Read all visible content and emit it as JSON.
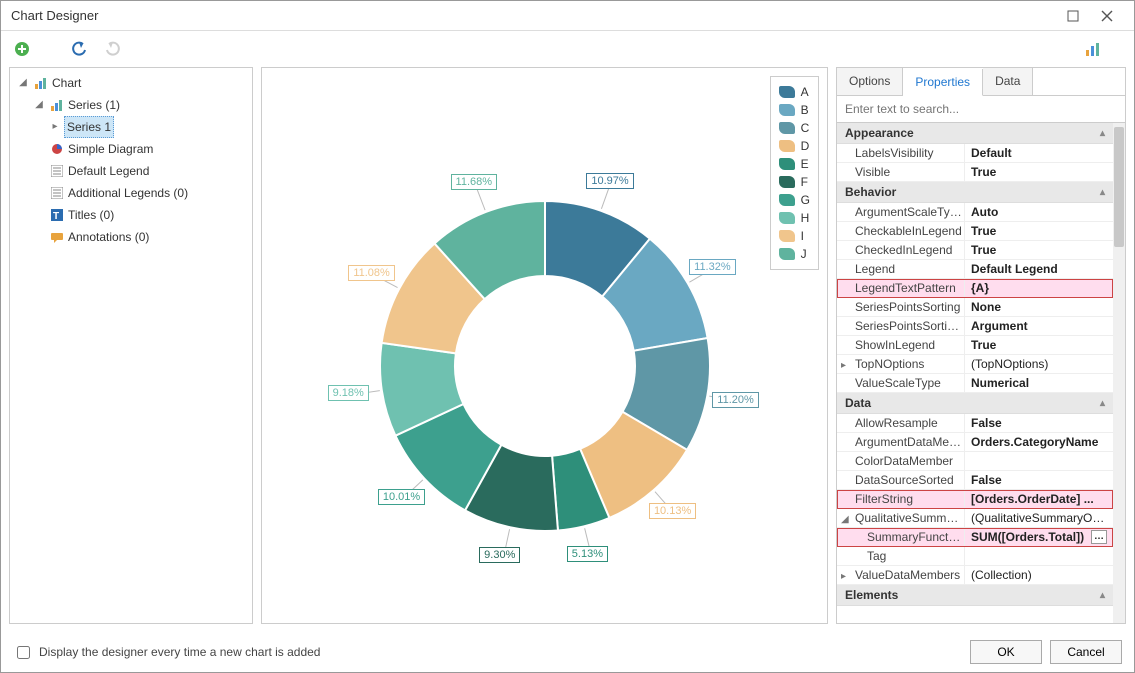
{
  "window": {
    "title": "Chart Designer"
  },
  "tree": {
    "root": "Chart",
    "series_group": "Series (1)",
    "series1": "Series 1",
    "simple_diagram": "Simple Diagram",
    "default_legend": "Default Legend",
    "additional_legends": "Additional Legends (0)",
    "titles": "Titles (0)",
    "annotations": "Annotations (0)"
  },
  "chart_data": {
    "type": "pie",
    "title": "",
    "categories": [
      "A",
      "B",
      "C",
      "D",
      "E",
      "F",
      "G",
      "H",
      "I",
      "J"
    ],
    "values": [
      10.97,
      11.32,
      11.2,
      10.13,
      5.13,
      9.3,
      10.01,
      9.18,
      11.08,
      11.68
    ],
    "labels": [
      "10.97%",
      "11.32%",
      "11.20%",
      "10.13%",
      "5.13%",
      "9.30%",
      "10.01%",
      "9.18%",
      "11.08%",
      "11.68%"
    ],
    "colors": [
      "#3c7a99",
      "#6aa8c2",
      "#5f97a6",
      "#eebf82",
      "#2e8f7a",
      "#2a6b5d",
      "#3da08e",
      "#6fc1b0",
      "#f0c58c",
      "#5fb39e"
    ]
  },
  "tabs": {
    "options": "Options",
    "properties": "Properties",
    "data": "Data"
  },
  "search": {
    "placeholder": "Enter text to search..."
  },
  "propgrid": {
    "cat_appearance": "Appearance",
    "labels_visibility": {
      "name": "LabelsVisibility",
      "value": "Default"
    },
    "visible": {
      "name": "Visible",
      "value": "True"
    },
    "cat_behavior": "Behavior",
    "argument_scale_type": {
      "name": "ArgumentScaleType",
      "value": "Auto"
    },
    "checkable_in_legend": {
      "name": "CheckableInLegend",
      "value": "True"
    },
    "checked_in_legend": {
      "name": "CheckedInLegend",
      "value": "True"
    },
    "legend": {
      "name": "Legend",
      "value": "Default Legend"
    },
    "legend_text_pattern": {
      "name": "LegendTextPattern",
      "value": "{A}"
    },
    "series_points_sorting": {
      "name": "SeriesPointsSorting",
      "value": "None"
    },
    "series_points_sorting_key": {
      "name": "SeriesPointsSorting...",
      "value": "Argument"
    },
    "show_in_legend": {
      "name": "ShowInLegend",
      "value": "True"
    },
    "topn_options": {
      "name": "TopNOptions",
      "value": "(TopNOptions)"
    },
    "value_scale_type": {
      "name": "ValueScaleType",
      "value": "Numerical"
    },
    "cat_data": "Data",
    "allow_resample": {
      "name": "AllowResample",
      "value": "False"
    },
    "argument_data_member": {
      "name": "ArgumentDataMem...",
      "value": "Orders.CategoryName"
    },
    "color_data_member": {
      "name": "ColorDataMember",
      "value": ""
    },
    "data_source_sorted": {
      "name": "DataSourceSorted",
      "value": "False"
    },
    "filter_string": {
      "name": "FilterString",
      "value": "[Orders.OrderDate] ..."
    },
    "qualitative_summary": {
      "name": "QualitativeSummary...",
      "value": "(QualitativeSummaryOpti..."
    },
    "summary_function": {
      "name": "SummaryFunction",
      "value": "SUM([Orders.Total])"
    },
    "tag": {
      "name": "Tag",
      "value": ""
    },
    "value_data_members": {
      "name": "ValueDataMembers",
      "value": "(Collection)"
    },
    "cat_elements": "Elements"
  },
  "footer": {
    "checkbox_label": "Display the designer every time a new chart is added",
    "ok": "OK",
    "cancel": "Cancel"
  }
}
